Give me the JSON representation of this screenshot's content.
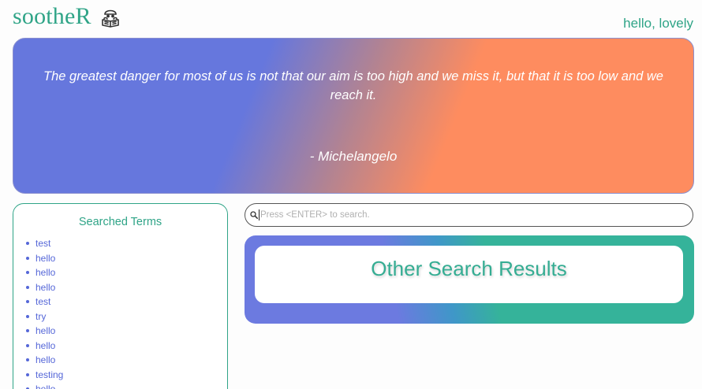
{
  "header": {
    "app_name": "sootheR",
    "logo_icon": "reading-person-icon",
    "greeting": "hello, lovely"
  },
  "quote": {
    "text": "The greatest danger for most of us is not that our aim is too high and we miss it, but that it is too low and we reach it.",
    "author": "- Michelangelo"
  },
  "searched_terms": {
    "title": "Searched Terms",
    "items": [
      "test",
      "hello",
      "hello",
      "hello",
      "test",
      "try",
      "hello",
      "hello",
      "hello",
      "testing",
      "hello"
    ]
  },
  "search": {
    "icon": "search-icon",
    "value": "",
    "placeholder": "Press <ENTER> to search."
  },
  "other_results": {
    "title": "Other Search Results"
  },
  "colors": {
    "brand_green": "#2fa487",
    "link_blue": "#5567d8",
    "banner_purple": "#6677dd",
    "banner_orange": "#fe8c5f"
  }
}
